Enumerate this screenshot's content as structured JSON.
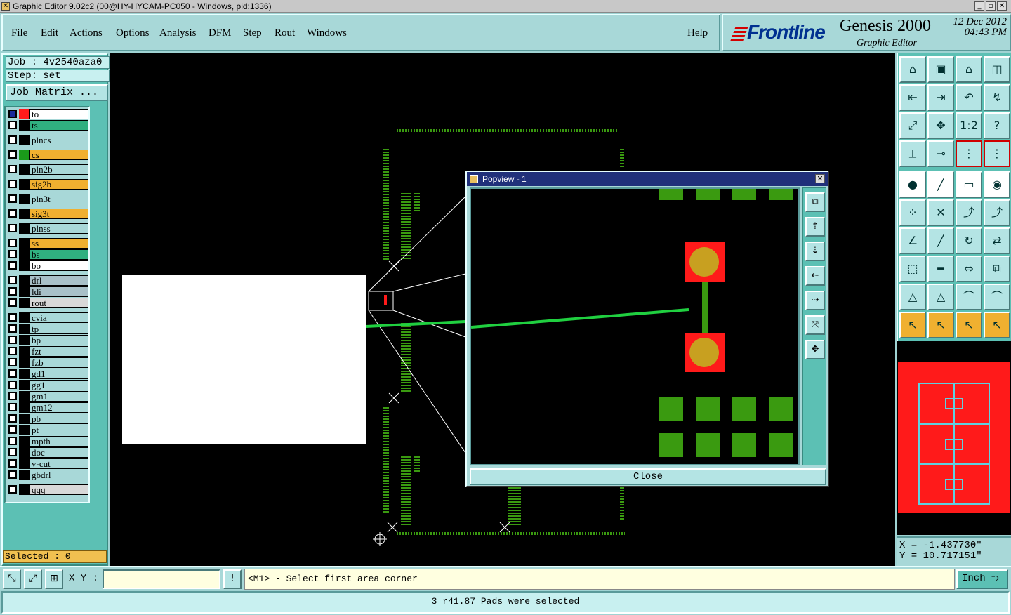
{
  "window": {
    "title": "Graphic Editor 9.02c2 (00@HY-HYCAM-PC050 - Windows, pid:1336)",
    "buttons": [
      "_",
      "▫",
      "✕"
    ]
  },
  "menu": {
    "items": [
      "File",
      "Edit",
      "Actions",
      "Options",
      "Analysis",
      "DFM",
      "Step",
      "Rout",
      "Windows"
    ],
    "help": "Help"
  },
  "brand": {
    "logo": "Frontline",
    "product": "Genesis 2000",
    "subtitle": "Graphic Editor",
    "date_line1": "12  Dec 2012",
    "date_line2": "04:43 PM"
  },
  "job": {
    "job_label": "Job : 4v2540aza0",
    "step_label": "Step: set",
    "matrix_button": "Job Matrix ..."
  },
  "layers": [
    {
      "name": "to",
      "color": "#ffffff",
      "swatch": "#ff1a1a"
    },
    {
      "name": "ts",
      "color": "#30b080",
      "swatch": "#000000"
    },
    {
      "name": "plncs",
      "color": "#a8d8d8",
      "swatch": "#000000"
    },
    {
      "name": "cs",
      "color": "#f0b030",
      "swatch": "#1a9a1a"
    },
    {
      "name": "pln2b",
      "color": "#a8d8d8",
      "swatch": "#000000"
    },
    {
      "name": "sig2b",
      "color": "#f0b030",
      "swatch": "#000000"
    },
    {
      "name": "pln3t",
      "color": "#a8d8d8",
      "swatch": "#000000"
    },
    {
      "name": "sig3t",
      "color": "#f0b030",
      "swatch": "#000000"
    },
    {
      "name": "plnss",
      "color": "#a8d8d8",
      "swatch": "#000000"
    },
    {
      "name": "ss",
      "color": "#f0b030",
      "swatch": "#000000"
    },
    {
      "name": "bs",
      "color": "#30b080",
      "swatch": "#000000"
    },
    {
      "name": "bo",
      "color": "#ffffff",
      "swatch": "#000000"
    },
    {
      "name": "drl",
      "color": "#a8c0c8",
      "swatch": "#000000"
    },
    {
      "name": "ldi",
      "color": "#a8c0c8",
      "swatch": "#000000"
    },
    {
      "name": "rout",
      "color": "#d8d8d8",
      "swatch": "#000000"
    },
    {
      "name": "cvia",
      "color": "#a8d8d8",
      "swatch": "#000000"
    },
    {
      "name": "tp",
      "color": "#a8d8d8",
      "swatch": "#000000"
    },
    {
      "name": "bp",
      "color": "#a8d8d8",
      "swatch": "#000000"
    },
    {
      "name": "fzt",
      "color": "#a8d8d8",
      "swatch": "#000000"
    },
    {
      "name": "fzb",
      "color": "#a8d8d8",
      "swatch": "#000000"
    },
    {
      "name": "gd1",
      "color": "#a8d8d8",
      "swatch": "#000000"
    },
    {
      "name": "gg1",
      "color": "#a8d8d8",
      "swatch": "#000000"
    },
    {
      "name": "gm1",
      "color": "#a8d8d8",
      "swatch": "#000000"
    },
    {
      "name": "gm12",
      "color": "#a8d8d8",
      "swatch": "#000000"
    },
    {
      "name": "pb",
      "color": "#a8d8d8",
      "swatch": "#000000"
    },
    {
      "name": "pt",
      "color": "#a8d8d8",
      "swatch": "#000000"
    },
    {
      "name": "mpth",
      "color": "#a8d8d8",
      "swatch": "#000000"
    },
    {
      "name": "doc",
      "color": "#a8d8d8",
      "swatch": "#000000"
    },
    {
      "name": "v-cut",
      "color": "#a8d8d8",
      "swatch": "#000000"
    },
    {
      "name": "gbdrl",
      "color": "#a8d8d8",
      "swatch": "#000000"
    },
    {
      "name": "qqq",
      "color": "#d8d8d8",
      "swatch": "#000000"
    }
  ],
  "selected_label": "Selected : 0",
  "popview": {
    "title": "Popview - 1",
    "close_label": "Close"
  },
  "coords": {
    "x": "X = -1.437730\"",
    "y": "Y = 10.717151\""
  },
  "command": {
    "xy_label": "X Y :",
    "xy_value": "",
    "prompt": "<M1> - Select first area corner",
    "units": "Inch"
  },
  "status": "3 r41.87 Pads were selected",
  "colors": {
    "canvas": "#000000",
    "pad_red": "#ff1a1a",
    "pad_gold": "#c8a020",
    "feature_green": "#3a9a10",
    "selection_line": "#20d040",
    "panel_teal": "#5cc0b4"
  }
}
